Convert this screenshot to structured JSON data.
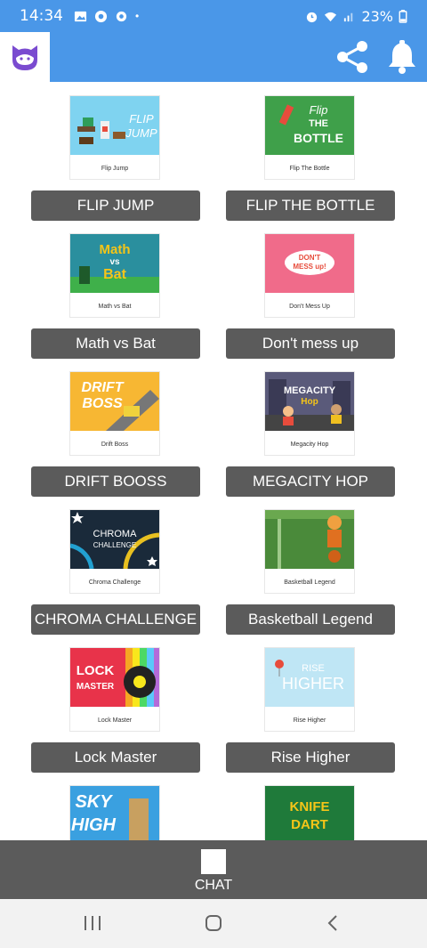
{
  "status_bar": {
    "time": "14:34",
    "dot": "•",
    "battery": "23%",
    "icons": [
      "image-icon",
      "chrome-icon",
      "settings-icon",
      "alarm-icon",
      "wifi-icon",
      "signal-icon",
      "battery-icon"
    ]
  },
  "app_bar": {
    "logo_icon": "cat-logo-icon",
    "actions": [
      "share-icon",
      "bell-icon"
    ]
  },
  "games": [
    {
      "caption": "Flip Jump",
      "button": "FLIP JUMP"
    },
    {
      "caption": "Flip The Bottle",
      "button": "FLIP THE BOTTLE"
    },
    {
      "caption": "Math vs Bat",
      "button": "Math vs Bat"
    },
    {
      "caption": "Don't Mess Up",
      "button": "Don't mess up"
    },
    {
      "caption": "Drift Boss",
      "button": "DRIFT BOOSS"
    },
    {
      "caption": "Megacity Hop",
      "button": "MEGACITY HOP"
    },
    {
      "caption": "Chroma Challenge",
      "button": "CHROMA CHALLENGE"
    },
    {
      "caption": "Basketball Legend",
      "button": "Basketball Legend"
    },
    {
      "caption": "Lock Master",
      "button": "Lock Master"
    },
    {
      "caption": "Rise Higher",
      "button": "Rise Higher"
    },
    {
      "caption": "",
      "button": ""
    },
    {
      "caption": "",
      "button": ""
    }
  ],
  "thumb_text": {
    "flip_jump": [
      "FLIP",
      "JUMP"
    ],
    "flip_bottle": [
      "Flip",
      "THE",
      "BOTTLE"
    ],
    "math_bat": [
      "Math",
      "vs",
      "Bat"
    ],
    "dont_mess": [
      "DON'T",
      "MESS up!"
    ],
    "drift_boss": [
      "DRIFT",
      "BOSS"
    ],
    "megacity": [
      "MEGACITY",
      "Hop"
    ],
    "chroma": [
      "CHROMA",
      "CHALLENGE"
    ],
    "lock_master": [
      "LOCK",
      "MASTER"
    ],
    "rise_higher": [
      "RISE",
      "HIGHER"
    ],
    "sky_high": [
      "SKY",
      "HIGH"
    ],
    "knife_dart": [
      "KNIFE",
      "DART"
    ]
  },
  "bottom_bar": {
    "chat_label": "CHAT"
  },
  "nav_bar": {
    "buttons": [
      "recents-icon",
      "home-icon",
      "back-icon"
    ]
  },
  "colors": {
    "primary": "#4a97e8",
    "button": "#5b5b5b",
    "navbar": "#f2f2f2"
  }
}
